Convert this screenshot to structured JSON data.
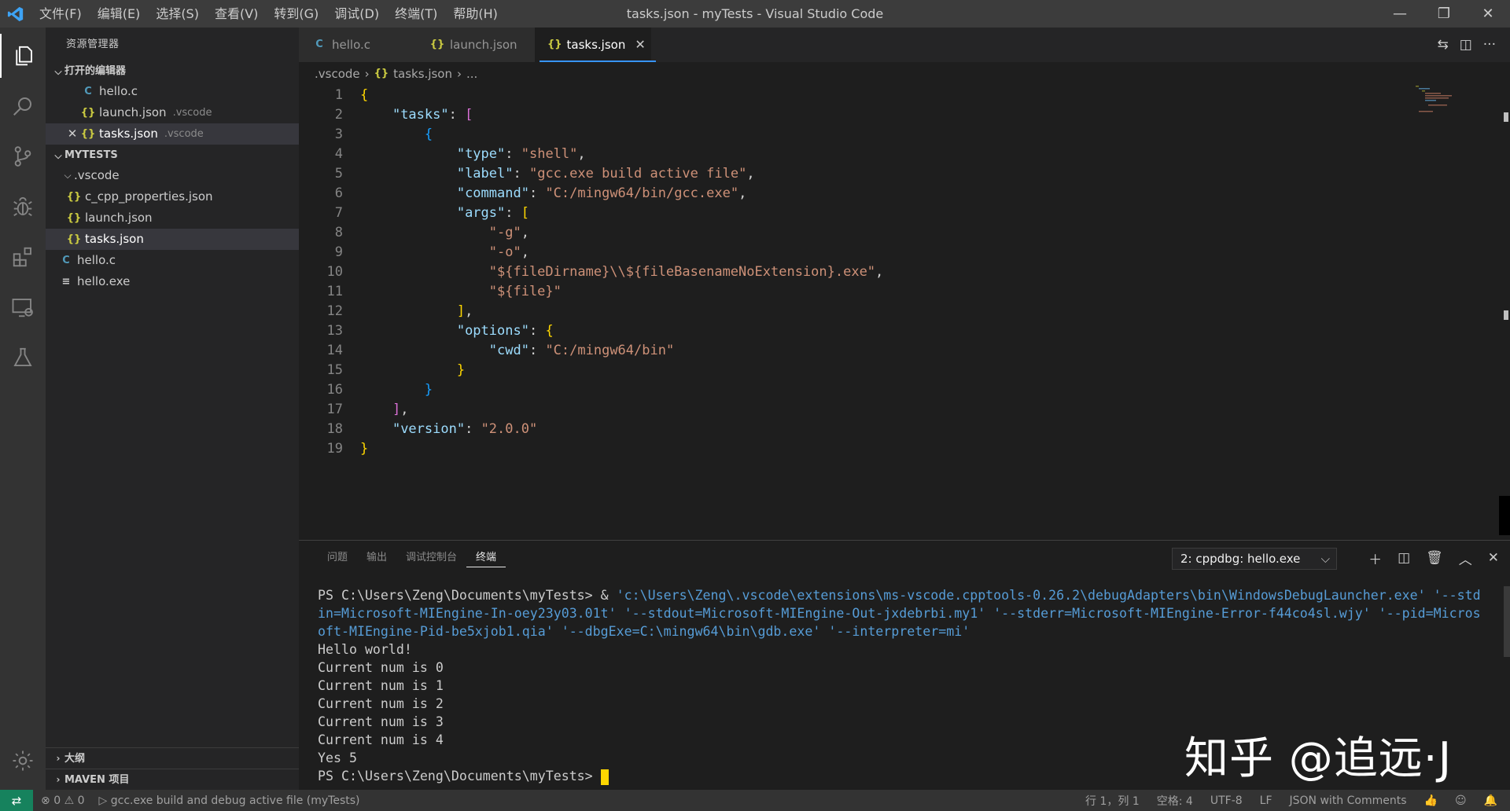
{
  "titlebar": {
    "menu": [
      "文件(F)",
      "编辑(E)",
      "选择(S)",
      "查看(V)",
      "转到(G)",
      "调试(D)",
      "终端(T)",
      "帮助(H)"
    ],
    "title": "tasks.json - myTests - Visual Studio Code"
  },
  "sidebar": {
    "title": "资源管理器",
    "open_editors_label": "打开的编辑器",
    "open_editors": [
      {
        "name": "hello.c",
        "hint": "",
        "icon": "c-file-icon"
      },
      {
        "name": "launch.json",
        "hint": ".vscode",
        "icon": "json-file-icon"
      },
      {
        "name": "tasks.json",
        "hint": ".vscode",
        "icon": "json-file-icon"
      }
    ],
    "workspace_label": "MYTESTS",
    "folder": ".vscode",
    "folder_files": [
      "c_cpp_properties.json",
      "launch.json",
      "tasks.json"
    ],
    "root_files": [
      "hello.c",
      "hello.exe"
    ],
    "outline_label": "大纲",
    "maven_label": "MAVEN 项目"
  },
  "editor": {
    "tabs": [
      {
        "label": "hello.c",
        "icon": "C"
      },
      {
        "label": "launch.json",
        "icon": "{}"
      },
      {
        "label": "tasks.json",
        "icon": "{}"
      }
    ],
    "active_tab": "tasks.json",
    "breadcrumb": [
      ".vscode",
      "tasks.json",
      "..."
    ],
    "line_numbers": [
      "1",
      "2",
      "3",
      "4",
      "5",
      "6",
      "7",
      "8",
      "9",
      "10",
      "11",
      "12",
      "13",
      "14",
      "15",
      "16",
      "17",
      "18",
      "19"
    ]
  },
  "panel": {
    "tabs": [
      "问题",
      "输出",
      "调试控制台",
      "终端"
    ],
    "active_tab": "终端",
    "terminal_select": "2: cppdbg: hello.exe",
    "terminal": {
      "prompt1": "PS C:\\Users\\Zeng\\Documents\\myTests> ",
      "cmd_amp": "& ",
      "cmd_args": "'c:\\Users\\Zeng\\.vscode\\extensions\\ms-vscode.cpptools-0.26.2\\debugAdapters\\bin\\WindowsDebugLauncher.exe' '--stdin=Microsoft-MIEngine-In-oey23y03.01t' '--stdout=Microsoft-MIEngine-Out-jxdebrbi.my1' '--stderr=Microsoft-MIEngine-Error-f44co4sl.wjy' '--pid=Microsoft-MIEngine-Pid-be5xjob1.qia' '--dbgExe=C:\\mingw64\\bin\\gdb.exe' '--interpreter=mi'",
      "output": [
        "Hello world!",
        "Current num is 0",
        "Current num is 1",
        "Current num is 2",
        "Current num is 3",
        "Current num is 4",
        "Yes 5"
      ],
      "prompt2": "PS C:\\Users\\Zeng\\Documents\\myTests> "
    }
  },
  "watermark": "知乎 @追远·J",
  "statusbar": {
    "errors": "0",
    "warnings": "0",
    "task": "gcc.exe build and debug active file (myTests)",
    "position": "行 1，列 1",
    "spaces": "空格: 4",
    "encoding": "UTF-8",
    "eol": "LF",
    "language": "JSON with Comments"
  },
  "colors": {
    "accent": "#3794ff",
    "remote": "#16825d",
    "activity_bar": "#333333",
    "sidebar": "#252526",
    "editor": "#1e1e1e"
  }
}
